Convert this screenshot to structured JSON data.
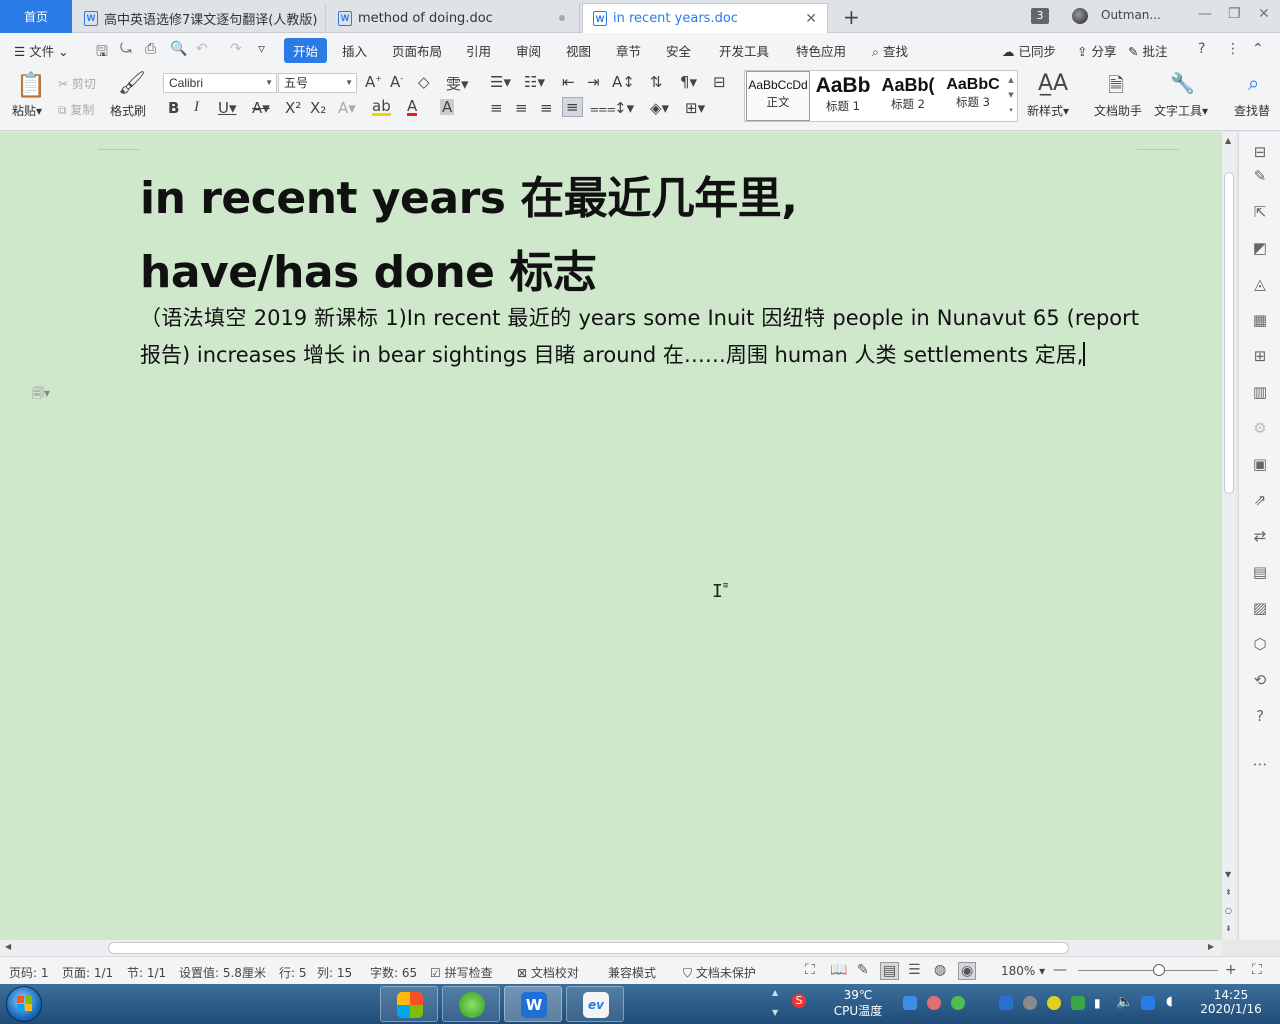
{
  "tabs": {
    "home": "首页",
    "docs": [
      {
        "title": "高中英语选修7课文逐句翻译(人教版)"
      },
      {
        "title": "method of doing.doc"
      },
      {
        "title": "in recent years.doc"
      }
    ],
    "window_count": "3",
    "user": "Outman..."
  },
  "menu": {
    "file": "文件",
    "items": [
      "开始",
      "插入",
      "页面布局",
      "引用",
      "审阅",
      "视图",
      "章节",
      "安全",
      "开发工具",
      "特色应用"
    ],
    "search": "查找",
    "sync": "已同步",
    "share": "分享",
    "comment": "批注"
  },
  "ribbon": {
    "paste": "粘贴",
    "cut": "剪切",
    "copy": "复制",
    "format_painter": "格式刷",
    "font_name": "Calibri",
    "font_size": "五号",
    "styles": [
      {
        "preview": "AaBbCcDd",
        "label": "正文"
      },
      {
        "preview": "AaBb",
        "label": "标题 1"
      },
      {
        "preview": "AaBb(",
        "label": "标题 2"
      },
      {
        "preview": "AaBbC",
        "label": "标题 3"
      }
    ],
    "new_style": "新样式",
    "doc_assistant": "文档助手",
    "text_tools": "文字工具",
    "find_replace": "查找替"
  },
  "document": {
    "heading1": "in recent years 在最近几年里,",
    "heading2": "have/has done 标志",
    "paragraph": "（语法填空 2019 新课标 1)In recent 最近的  years some Inuit  因纽特 people in Nunavut     65 (report 报告) increases  增长 in bear sightings  目睹 around  在……周围 human  人类 settlements 定居,"
  },
  "status": {
    "page_no": "页码: 1",
    "pages": "页面: 1/1",
    "section": "节: 1/1",
    "setting": "设置值: 5.8厘米",
    "row": "行: 5",
    "col": "列: 15",
    "word_count": "字数: 65",
    "spell_check": "拼写检查",
    "doc_proof": "文档校对",
    "compat_mode": "兼容模式",
    "unprotected": "文档未保护",
    "zoom": "180%"
  },
  "taskbar": {
    "temp": "39℃",
    "cpu_label": "CPU温度",
    "time": "14:25",
    "date": "2020/1/16"
  },
  "colors": {
    "accent": "#2a7be6",
    "doc_bg": "#cfe8cc",
    "chrome_bg": "#f3f4f6"
  }
}
